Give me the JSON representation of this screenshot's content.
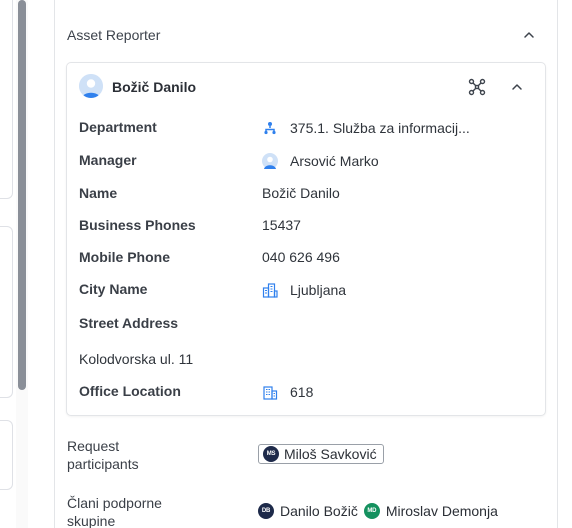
{
  "section": {
    "title": "Asset Reporter"
  },
  "reporter": {
    "name": "Božič Danilo",
    "fields": {
      "department_label": "Department",
      "department_value": "375.1. Služba za informacij...",
      "manager_label": "Manager",
      "manager_value": "Arsović Marko",
      "name_label": "Name",
      "name_value": "Božič Danilo",
      "business_phones_label": "Business Phones",
      "business_phones_value": "15437",
      "mobile_phone_label": "Mobile Phone",
      "mobile_phone_value": "040 626 496",
      "city_label": "City Name",
      "city_value": "Ljubljana",
      "street_label": "Street Address",
      "street_value": "Kolodvorska ul. 11",
      "office_label": "Office Location",
      "office_value": "618"
    }
  },
  "request_participants": {
    "label": "Request participants",
    "people": [
      {
        "initials": "MS",
        "name": "Miloš Savković",
        "color": "#1e2a4a"
      }
    ]
  },
  "support_group": {
    "label": "Člani podporne skupine",
    "members": [
      {
        "initials": "DB",
        "name": "Danilo Božič",
        "color": "#1e2a4a"
      },
      {
        "initials": "MD",
        "name": "Miroslav Demonja",
        "color": "#15915f"
      }
    ]
  },
  "icons": {
    "collapse": "chevron-up-icon",
    "network": "network-graph-icon",
    "department": "org-hierarchy-icon",
    "manager": "user-avatar-icon",
    "city": "city-icon",
    "office": "building-icon"
  },
  "colors": {
    "accent": "#2f80ed",
    "border": "#e3e5e8"
  }
}
